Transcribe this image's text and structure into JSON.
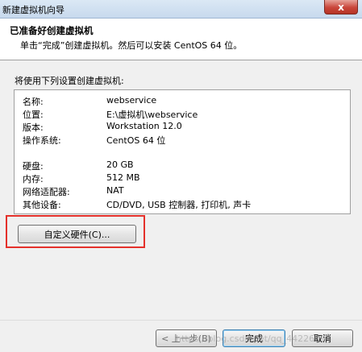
{
  "window": {
    "title": "新建虚拟机向导",
    "close_glyph": "x"
  },
  "header": {
    "title": "已准备好创建虚拟机",
    "subtitle": "单击“完成”创建虚拟机。然后可以安装 CentOS 64 位。"
  },
  "section_label": "将使用下列设置创建虚拟机:",
  "settings": [
    {
      "key": "名称:",
      "value": "webservice"
    },
    {
      "key": "位置:",
      "value": "E:\\虚拟机\\webservice"
    },
    {
      "key": "版本:",
      "value": "Workstation 12.0"
    },
    {
      "key": "操作系统:",
      "value": "CentOS 64 位"
    },
    {
      "key": "硬盘:",
      "value": "20 GB"
    },
    {
      "key": "内存:",
      "value": "512 MB"
    },
    {
      "key": "网络适配器:",
      "value": "NAT"
    },
    {
      "key": "其他设备:",
      "value": "CD/DVD, USB 控制器, 打印机, 声卡"
    }
  ],
  "buttons": {
    "customize": "自定义硬件(C)...",
    "back": "< 上一步(B)",
    "finish": "完成",
    "cancel": "取消"
  },
  "watermark": "https://blog.csdn.net/qq_44226094",
  "colors": {
    "highlight": "#e4312b",
    "close_button": "#c9463a"
  }
}
